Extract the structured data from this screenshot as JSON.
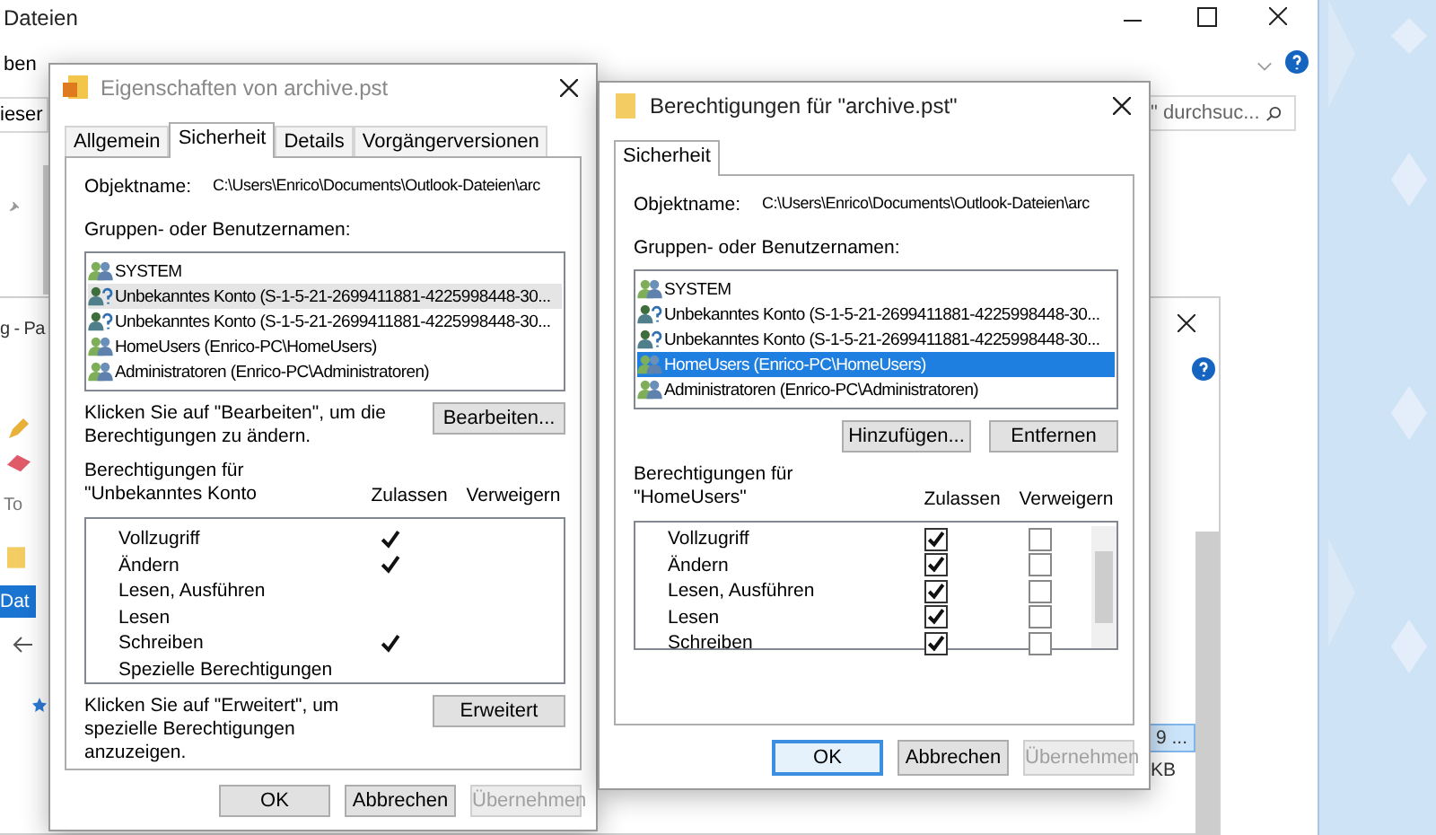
{
  "explorer": {
    "title": "Dateien",
    "menu": "ben",
    "address": "ieser",
    "search_placeholder": "\" durchsuc..."
  },
  "paint": {
    "title": "g - Pa",
    "group": "To",
    "nav_tab": "Dat",
    "file_button": "9 ...",
    "size": "KB"
  },
  "properties_dialog": {
    "title": "Eigenschaften von archive.pst",
    "tabs": [
      {
        "label": "Allgemein",
        "selected": false
      },
      {
        "label": "Sicherheit",
        "selected": true
      },
      {
        "label": "Details",
        "selected": false
      },
      {
        "label": "Vorgängerversionen",
        "selected": false
      }
    ],
    "object_label": "Objektname:",
    "object_path": "C:\\Users\\Enrico\\Documents\\Outlook-Dateien\\arc",
    "users_label": "Gruppen- oder Benutzernamen:",
    "users": [
      {
        "kind": "group",
        "name": "SYSTEM",
        "selected": false
      },
      {
        "kind": "unknown",
        "name": "Unbekanntes Konto (S-1-5-21-2699411881-4225998448-30...",
        "selected": true
      },
      {
        "kind": "unknown",
        "name": "Unbekanntes Konto (S-1-5-21-2699411881-4225998448-30...",
        "selected": false
      },
      {
        "kind": "group",
        "name": "HomeUsers (Enrico-PC\\HomeUsers)",
        "selected": false
      },
      {
        "kind": "group",
        "name": "Administratoren (Enrico-PC\\Administratoren)",
        "selected": false
      }
    ],
    "edit_hint": "Klicken Sie auf \"Bearbeiten\", um die Berechtigungen zu ändern.",
    "edit_button": "Bearbeiten...",
    "perm_label": "Berechtigungen für \"Unbekanntes Konto",
    "allow_header": "Zulassen",
    "deny_header": "Verweigern",
    "permissions": [
      {
        "name": "Vollzugriff",
        "allow": true,
        "deny": false
      },
      {
        "name": "Ändern",
        "allow": true,
        "deny": false
      },
      {
        "name": "Lesen, Ausführen",
        "allow": false,
        "deny": false
      },
      {
        "name": "Lesen",
        "allow": false,
        "deny": false
      },
      {
        "name": "Schreiben",
        "allow": true,
        "deny": false
      },
      {
        "name": "Spezielle Berechtigungen",
        "allow": false,
        "deny": false
      }
    ],
    "advanced_hint": "Klicken Sie auf \"Erweitert\", um spezielle Berechtigungen anzuzeigen.",
    "advanced_button": "Erweitert",
    "buttons": [
      {
        "label": "OK",
        "disabled": false,
        "default": false
      },
      {
        "label": "Abbrechen",
        "disabled": false,
        "default": false
      },
      {
        "label": "Übernehmen",
        "disabled": true,
        "default": false
      }
    ]
  },
  "permissions_dialog": {
    "title": "Berechtigungen für \"archive.pst\"",
    "tabs": [
      {
        "label": "Sicherheit",
        "selected": true
      }
    ],
    "object_label": "Objektname:",
    "object_path": "C:\\Users\\Enrico\\Documents\\Outlook-Dateien\\arc",
    "users_label": "Gruppen- oder Benutzernamen:",
    "users": [
      {
        "kind": "group",
        "name": "SYSTEM",
        "selected": false
      },
      {
        "kind": "unknown",
        "name": "Unbekanntes Konto (S-1-5-21-2699411881-4225998448-30...",
        "selected": false
      },
      {
        "kind": "unknown",
        "name": "Unbekanntes Konto (S-1-5-21-2699411881-4225998448-30...",
        "selected": false
      },
      {
        "kind": "group",
        "name": "HomeUsers (Enrico-PC\\HomeUsers)",
        "selected": true
      },
      {
        "kind": "group",
        "name": "Administratoren (Enrico-PC\\Administratoren)",
        "selected": false
      }
    ],
    "add_button": "Hinzufügen...",
    "remove_button": "Entfernen",
    "perm_label": "Berechtigungen für \"HomeUsers\"",
    "allow_header": "Zulassen",
    "deny_header": "Verweigern",
    "permissions": [
      {
        "name": "Vollzugriff",
        "allow": true,
        "deny": false
      },
      {
        "name": "Ändern",
        "allow": true,
        "deny": false
      },
      {
        "name": "Lesen, Ausführen",
        "allow": true,
        "deny": false
      },
      {
        "name": "Lesen",
        "allow": true,
        "deny": false
      },
      {
        "name": "Schreiben",
        "allow": true,
        "deny": false
      }
    ],
    "buttons": [
      {
        "label": "OK",
        "disabled": false,
        "default": true
      },
      {
        "label": "Abbrechen",
        "disabled": false,
        "default": false
      },
      {
        "label": "Übernehmen",
        "disabled": true,
        "default": false
      }
    ]
  }
}
